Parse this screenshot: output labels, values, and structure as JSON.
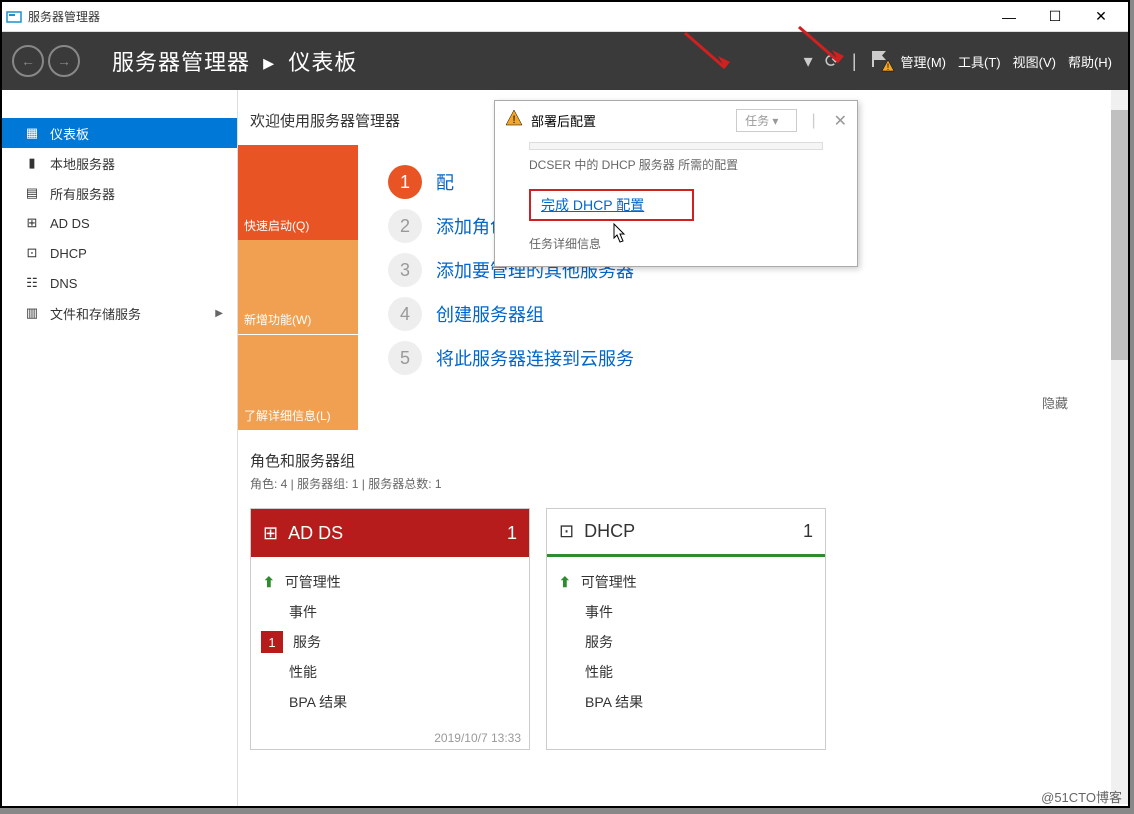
{
  "window": {
    "title": "服务器管理器"
  },
  "header": {
    "title_app": "服务器管理器",
    "title_page": "仪表板",
    "menu": {
      "manage": "管理(M)",
      "tools": "工具(T)",
      "view": "视图(V)",
      "help": "帮助(H)"
    }
  },
  "sidebar": {
    "items": [
      {
        "label": "仪表板",
        "icon": "dashboard"
      },
      {
        "label": "本地服务器",
        "icon": "server"
      },
      {
        "label": "所有服务器",
        "icon": "servers"
      },
      {
        "label": "AD DS",
        "icon": "adds"
      },
      {
        "label": "DHCP",
        "icon": "dhcp"
      },
      {
        "label": "DNS",
        "icon": "dns"
      },
      {
        "label": "文件和存储服务",
        "icon": "storage",
        "arrow": "▶"
      }
    ]
  },
  "welcome": "欢迎使用服务器管理器",
  "orange": {
    "quick": "快速启动(Q)",
    "whatsnew": "新增功能(W)",
    "learn": "了解详细信息(L)"
  },
  "steps": [
    {
      "num": "1",
      "label": "配"
    },
    {
      "num": "2",
      "label": "添加角色和功能"
    },
    {
      "num": "3",
      "label": "添加要管理的其他服务器"
    },
    {
      "num": "4",
      "label": "创建服务器组"
    },
    {
      "num": "5",
      "label": "将此服务器连接到云服务"
    }
  ],
  "hide": "隐藏",
  "roles": {
    "title": "角色和服务器组",
    "sub": "角色: 4 | 服务器组: 1 | 服务器总数: 1"
  },
  "tiles": [
    {
      "title": "AD DS",
      "count": "1",
      "style": "red",
      "rows": [
        {
          "icon": "up",
          "label": "可管理性"
        },
        {
          "icon": "",
          "label": "事件"
        },
        {
          "icon": "badge",
          "badge": "1",
          "label": "服务"
        },
        {
          "icon": "",
          "label": "性能"
        },
        {
          "icon": "",
          "label": "BPA 结果"
        }
      ],
      "timestamp": "2019/10/7 13:33"
    },
    {
      "title": "DHCP",
      "count": "1",
      "style": "white",
      "rows": [
        {
          "icon": "up",
          "label": "可管理性"
        },
        {
          "icon": "",
          "label": "事件"
        },
        {
          "icon": "",
          "label": "服务"
        },
        {
          "icon": "",
          "label": "性能"
        },
        {
          "icon": "",
          "label": "BPA 结果"
        }
      ]
    }
  ],
  "popup": {
    "title": "部署后配置",
    "tasks": "任务",
    "desc": "DCSER 中的 DHCP 服务器 所需的配置",
    "link": "完成 DHCP 配置",
    "detail": "任务详细信息"
  },
  "watermark": "@51CTO博客"
}
